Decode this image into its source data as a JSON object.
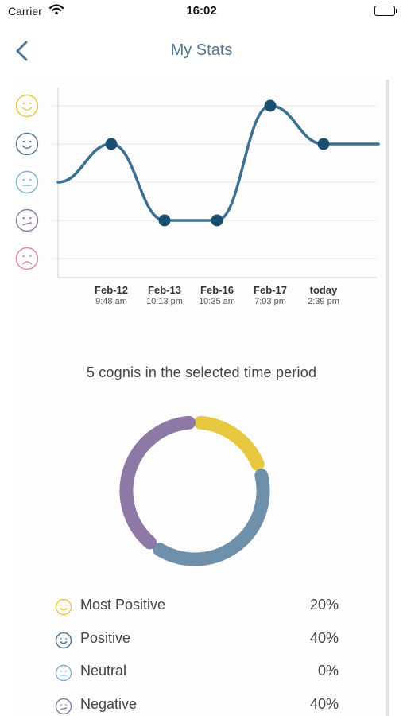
{
  "status_bar": {
    "carrier": "Carrier",
    "time": "16:02"
  },
  "nav": {
    "title": "My Stats",
    "back_icon": "chevron-left-icon"
  },
  "colors": {
    "accent": "#3c7090",
    "most_positive": "#e8c840",
    "positive": "#4f7494",
    "neutral": "#7fb2cf",
    "negative": "#8e78a6",
    "most_negative": "#d88aa0",
    "donut_positive": "#6f90ab",
    "grid": "#e6e6e6"
  },
  "chart_data": {
    "type": "line",
    "y_levels": [
      "Most Positive",
      "Positive",
      "Neutral",
      "Negative",
      "Most Negative"
    ],
    "y_level_icons": [
      "smile-icon",
      "smile-icon",
      "neutral-face-icon",
      "frown-icon",
      "sad-face-icon"
    ],
    "categories": [
      {
        "date": "Feb-12",
        "time": "9:48 am"
      },
      {
        "date": "Feb-13",
        "time": "10:13 pm"
      },
      {
        "date": "Feb-16",
        "time": "10:35 am"
      },
      {
        "date": "Feb-17",
        "time": "7:03 pm"
      },
      {
        "date": "today",
        "time": "2:39 pm"
      }
    ],
    "values": [
      "Positive",
      "Negative",
      "Negative",
      "Most Positive",
      "Positive"
    ],
    "grid": true
  },
  "summary": "5 cognis in the selected time period",
  "donut_data": {
    "type": "pie",
    "segments": [
      {
        "label": "Most Positive",
        "percent": 20
      },
      {
        "label": "Positive",
        "percent": 40
      },
      {
        "label": "Neutral",
        "percent": 0
      },
      {
        "label": "Negative",
        "percent": 40
      }
    ]
  },
  "legend": [
    {
      "label": "Most Positive",
      "value": "20%",
      "icon": "smile-icon"
    },
    {
      "label": "Positive",
      "value": "40%",
      "icon": "smile-icon"
    },
    {
      "label": "Neutral",
      "value": "0%",
      "icon": "neutral-face-icon"
    },
    {
      "label": "Negative",
      "value": "40%",
      "icon": "frown-icon"
    }
  ]
}
